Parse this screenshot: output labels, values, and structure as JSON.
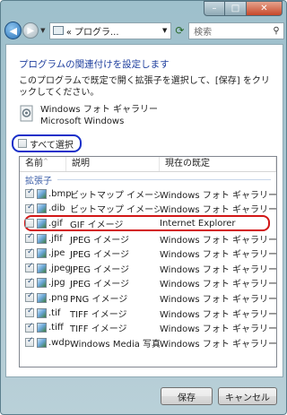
{
  "toolbar": {
    "address": "« プログラ...",
    "search_placeholder": "検索"
  },
  "dialog": {
    "heading": "プログラムの関連付けを設定します",
    "description": "このプログラムで既定で開く拡張子を選択して、[保存] をクリックしてください。",
    "program_name": "Windows フォト ギャラリー",
    "program_publisher": "Microsoft Windows",
    "select_all_label": "すべて選択"
  },
  "list": {
    "columns": [
      "名前",
      "説明",
      "現在の既定"
    ],
    "group": "拡張子",
    "rows": [
      {
        "checked": true,
        "ext": ".bmp",
        "desc": "ビットマップ イメージ",
        "current": "Windows フォト ギャラリー"
      },
      {
        "checked": true,
        "ext": ".dib",
        "desc": "ビットマップ イメージ",
        "current": "Windows フォト ギャラリー"
      },
      {
        "checked": false,
        "ext": ".gif",
        "desc": "GIF イメージ",
        "current": "Internet Explorer"
      },
      {
        "checked": true,
        "ext": ".jfif",
        "desc": "JPEG イメージ",
        "current": "Windows フォト ギャラリー"
      },
      {
        "checked": true,
        "ext": ".jpe",
        "desc": "JPEG イメージ",
        "current": "Windows フォト ギャラリー"
      },
      {
        "checked": true,
        "ext": ".jpeg",
        "desc": "JPEG イメージ",
        "current": "Windows フォト ギャラリー"
      },
      {
        "checked": true,
        "ext": ".jpg",
        "desc": "JPEG イメージ",
        "current": "Windows フォト ギャラリー"
      },
      {
        "checked": true,
        "ext": ".png",
        "desc": "PNG イメージ",
        "current": "Windows フォト ギャラリー"
      },
      {
        "checked": true,
        "ext": ".tif",
        "desc": "TIFF イメージ",
        "current": "Windows フォト ギャラリー"
      },
      {
        "checked": true,
        "ext": ".tiff",
        "desc": "TIFF イメージ",
        "current": "Windows フォト ギャラリー"
      },
      {
        "checked": true,
        "ext": ".wdp",
        "desc": "Windows Media 写真",
        "current": "Windows フォト ギャラリー"
      }
    ]
  },
  "buttons": {
    "save": "保存",
    "cancel": "キャンセル"
  },
  "colors": {
    "accent_blue": "#1930c9",
    "highlight_red": "#d21616"
  }
}
